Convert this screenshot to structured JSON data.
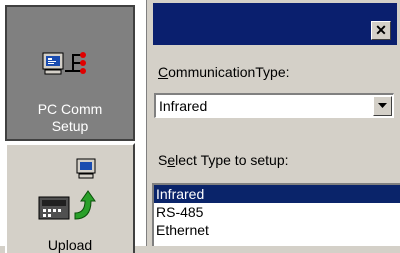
{
  "sidebar": {
    "items": [
      {
        "label_line1": "PC Comm",
        "label_line2": "Setup",
        "icon": "pc-network-icon",
        "active": true
      },
      {
        "label": "Upload",
        "icon": "device-upload-icon",
        "active": false
      }
    ]
  },
  "dialog": {
    "close_label": "✕",
    "communication_type": {
      "label_prefix": "C",
      "label_rest": "ommunicationType:",
      "value": "Infrared"
    },
    "select_type": {
      "label_prefix": "S",
      "label_underline": "e",
      "label_rest": "lect Type to setup:",
      "options": [
        "Infrared",
        "RS-485",
        "Ethernet"
      ],
      "selected_index": 0
    }
  },
  "colors": {
    "titlebar": "#0a1f6e",
    "selection": "#0a246a",
    "face": "#d4d0c8",
    "active_button": "#808080"
  }
}
